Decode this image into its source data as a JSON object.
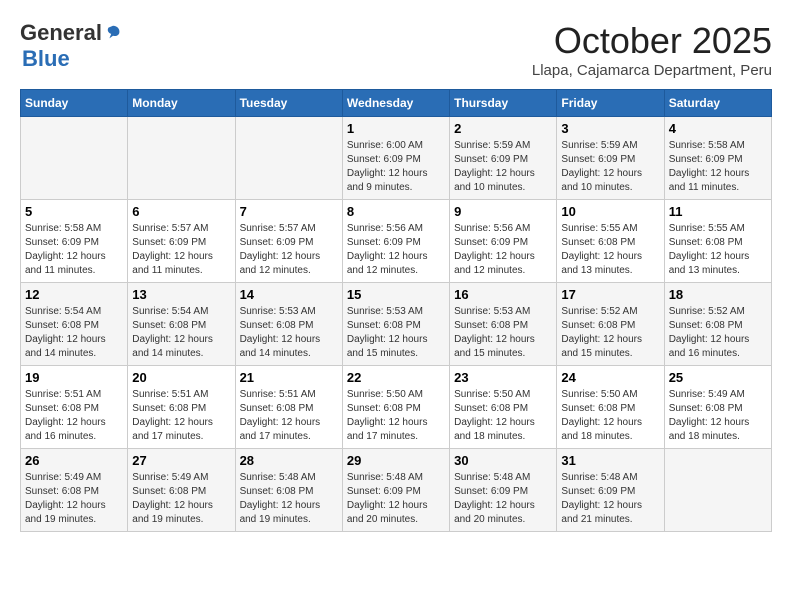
{
  "logo": {
    "general": "General",
    "blue": "Blue"
  },
  "title": "October 2025",
  "location": "Llapa, Cajamarca Department, Peru",
  "days_of_week": [
    "Sunday",
    "Monday",
    "Tuesday",
    "Wednesday",
    "Thursday",
    "Friday",
    "Saturday"
  ],
  "weeks": [
    [
      {
        "day": "",
        "info": ""
      },
      {
        "day": "",
        "info": ""
      },
      {
        "day": "",
        "info": ""
      },
      {
        "day": "1",
        "info": "Sunrise: 6:00 AM\nSunset: 6:09 PM\nDaylight: 12 hours and 9 minutes."
      },
      {
        "day": "2",
        "info": "Sunrise: 5:59 AM\nSunset: 6:09 PM\nDaylight: 12 hours and 10 minutes."
      },
      {
        "day": "3",
        "info": "Sunrise: 5:59 AM\nSunset: 6:09 PM\nDaylight: 12 hours and 10 minutes."
      },
      {
        "day": "4",
        "info": "Sunrise: 5:58 AM\nSunset: 6:09 PM\nDaylight: 12 hours and 11 minutes."
      }
    ],
    [
      {
        "day": "5",
        "info": "Sunrise: 5:58 AM\nSunset: 6:09 PM\nDaylight: 12 hours and 11 minutes."
      },
      {
        "day": "6",
        "info": "Sunrise: 5:57 AM\nSunset: 6:09 PM\nDaylight: 12 hours and 11 minutes."
      },
      {
        "day": "7",
        "info": "Sunrise: 5:57 AM\nSunset: 6:09 PM\nDaylight: 12 hours and 12 minutes."
      },
      {
        "day": "8",
        "info": "Sunrise: 5:56 AM\nSunset: 6:09 PM\nDaylight: 12 hours and 12 minutes."
      },
      {
        "day": "9",
        "info": "Sunrise: 5:56 AM\nSunset: 6:09 PM\nDaylight: 12 hours and 12 minutes."
      },
      {
        "day": "10",
        "info": "Sunrise: 5:55 AM\nSunset: 6:08 PM\nDaylight: 12 hours and 13 minutes."
      },
      {
        "day": "11",
        "info": "Sunrise: 5:55 AM\nSunset: 6:08 PM\nDaylight: 12 hours and 13 minutes."
      }
    ],
    [
      {
        "day": "12",
        "info": "Sunrise: 5:54 AM\nSunset: 6:08 PM\nDaylight: 12 hours and 14 minutes."
      },
      {
        "day": "13",
        "info": "Sunrise: 5:54 AM\nSunset: 6:08 PM\nDaylight: 12 hours and 14 minutes."
      },
      {
        "day": "14",
        "info": "Sunrise: 5:53 AM\nSunset: 6:08 PM\nDaylight: 12 hours and 14 minutes."
      },
      {
        "day": "15",
        "info": "Sunrise: 5:53 AM\nSunset: 6:08 PM\nDaylight: 12 hours and 15 minutes."
      },
      {
        "day": "16",
        "info": "Sunrise: 5:53 AM\nSunset: 6:08 PM\nDaylight: 12 hours and 15 minutes."
      },
      {
        "day": "17",
        "info": "Sunrise: 5:52 AM\nSunset: 6:08 PM\nDaylight: 12 hours and 15 minutes."
      },
      {
        "day": "18",
        "info": "Sunrise: 5:52 AM\nSunset: 6:08 PM\nDaylight: 12 hours and 16 minutes."
      }
    ],
    [
      {
        "day": "19",
        "info": "Sunrise: 5:51 AM\nSunset: 6:08 PM\nDaylight: 12 hours and 16 minutes."
      },
      {
        "day": "20",
        "info": "Sunrise: 5:51 AM\nSunset: 6:08 PM\nDaylight: 12 hours and 17 minutes."
      },
      {
        "day": "21",
        "info": "Sunrise: 5:51 AM\nSunset: 6:08 PM\nDaylight: 12 hours and 17 minutes."
      },
      {
        "day": "22",
        "info": "Sunrise: 5:50 AM\nSunset: 6:08 PM\nDaylight: 12 hours and 17 minutes."
      },
      {
        "day": "23",
        "info": "Sunrise: 5:50 AM\nSunset: 6:08 PM\nDaylight: 12 hours and 18 minutes."
      },
      {
        "day": "24",
        "info": "Sunrise: 5:50 AM\nSunset: 6:08 PM\nDaylight: 12 hours and 18 minutes."
      },
      {
        "day": "25",
        "info": "Sunrise: 5:49 AM\nSunset: 6:08 PM\nDaylight: 12 hours and 18 minutes."
      }
    ],
    [
      {
        "day": "26",
        "info": "Sunrise: 5:49 AM\nSunset: 6:08 PM\nDaylight: 12 hours and 19 minutes."
      },
      {
        "day": "27",
        "info": "Sunrise: 5:49 AM\nSunset: 6:08 PM\nDaylight: 12 hours and 19 minutes."
      },
      {
        "day": "28",
        "info": "Sunrise: 5:48 AM\nSunset: 6:08 PM\nDaylight: 12 hours and 19 minutes."
      },
      {
        "day": "29",
        "info": "Sunrise: 5:48 AM\nSunset: 6:09 PM\nDaylight: 12 hours and 20 minutes."
      },
      {
        "day": "30",
        "info": "Sunrise: 5:48 AM\nSunset: 6:09 PM\nDaylight: 12 hours and 20 minutes."
      },
      {
        "day": "31",
        "info": "Sunrise: 5:48 AM\nSunset: 6:09 PM\nDaylight: 12 hours and 21 minutes."
      },
      {
        "day": "",
        "info": ""
      }
    ]
  ]
}
